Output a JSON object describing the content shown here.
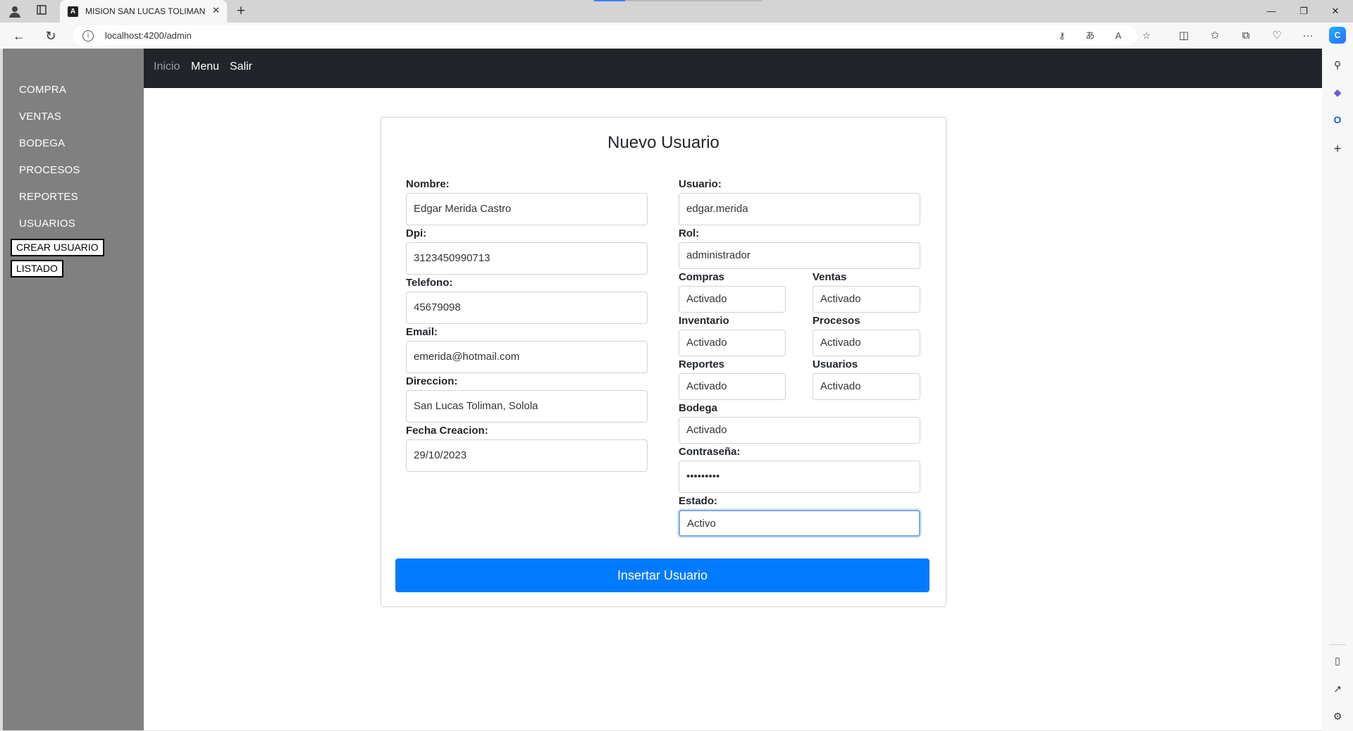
{
  "browser": {
    "tab_title": "MISION SAN LUCAS TOLIMAN",
    "url": "localhost:4200/admin"
  },
  "sidebar": {
    "items": [
      {
        "label": "COMPRA"
      },
      {
        "label": "VENTAS"
      },
      {
        "label": "BODEGA"
      },
      {
        "label": "PROCESOS"
      },
      {
        "label": "REPORTES"
      },
      {
        "label": "USUARIOS"
      }
    ],
    "sub_items": [
      {
        "label": "CREAR USUARIO"
      },
      {
        "label": "LISTADO"
      }
    ]
  },
  "topnav": {
    "links": [
      {
        "label": "Inicio"
      },
      {
        "label": "Menu"
      },
      {
        "label": "Salir"
      }
    ]
  },
  "form": {
    "title": "Nuevo Usuario",
    "nombre": {
      "label": "Nombre:",
      "value": "Edgar Merida Castro"
    },
    "dpi": {
      "label": "Dpi:",
      "value": "3123450990713"
    },
    "telefono": {
      "label": "Telefono:",
      "value": "45679098"
    },
    "email": {
      "label": "Email:",
      "value": "emerida@hotmail.com"
    },
    "direccion": {
      "label": "Direccion:",
      "value": "San Lucas Toliman, Solola"
    },
    "fecha": {
      "label": "Fecha Creacion:",
      "value": "29/10/2023"
    },
    "usuario": {
      "label": "Usuario:",
      "value": "edgar.merida"
    },
    "rol": {
      "label": "Rol:",
      "value": "administrador"
    },
    "compras": {
      "label": "Compras",
      "value": "Activado"
    },
    "ventas": {
      "label": "Ventas",
      "value": "Activado"
    },
    "inventario": {
      "label": "Inventario",
      "value": "Activado"
    },
    "procesos": {
      "label": "Procesos",
      "value": "Activado"
    },
    "reportes": {
      "label": "Reportes",
      "value": "Activado"
    },
    "usuarios": {
      "label": "Usuarios",
      "value": "Activado"
    },
    "bodega": {
      "label": "Bodega",
      "value": "Activado"
    },
    "contrasena": {
      "label": "Contraseña:",
      "value": "•••••••••"
    },
    "estado": {
      "label": "Estado:",
      "value": "Activo"
    },
    "submit_label": "Insertar Usuario"
  },
  "colors": {
    "sidebar_bg": "#808080",
    "topnav_bg": "#212529",
    "primary_button": "#007bff"
  }
}
